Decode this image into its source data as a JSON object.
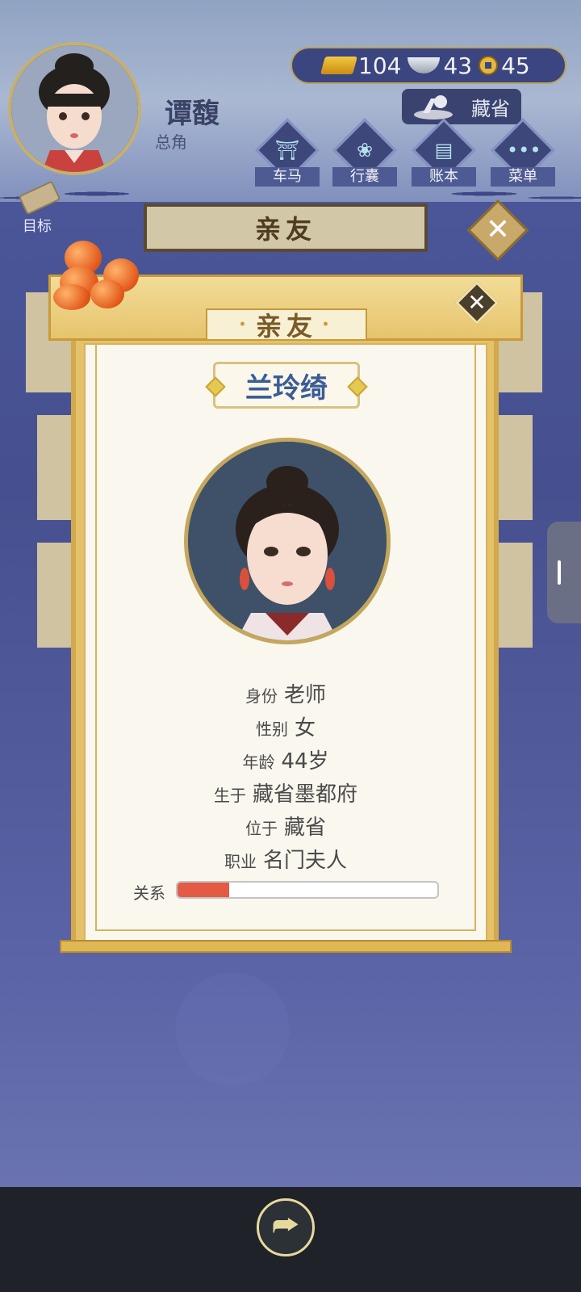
{
  "player": {
    "name": "谭馥",
    "role": "总角"
  },
  "currency": {
    "gold": "104",
    "silver": "43",
    "copper": "45"
  },
  "location": {
    "label": "藏省"
  },
  "menu": {
    "items": [
      {
        "label": "车马",
        "icon": "carriage-icon"
      },
      {
        "label": "行囊",
        "icon": "bag-icon"
      },
      {
        "label": "账本",
        "icon": "ledger-icon"
      },
      {
        "label": "菜单",
        "icon": "menu-dots-icon"
      }
    ]
  },
  "goal": {
    "label": "目标"
  },
  "screen": {
    "title": "亲友",
    "close": "✕"
  },
  "modal": {
    "title": "亲友",
    "close": "✕",
    "character_name": "兰玲绮",
    "fields": [
      {
        "key": "身份",
        "value": "老师"
      },
      {
        "key": "性别",
        "value": "女"
      },
      {
        "key": "年龄",
        "value": "44岁"
      },
      {
        "key": "生于",
        "value": "藏省墨都府"
      },
      {
        "key": "位于",
        "value": "藏省"
      },
      {
        "key": "职业",
        "value": "名门夫人"
      }
    ],
    "relationship": {
      "label": "关系",
      "fraction": 0.2,
      "color": "#e35b44"
    }
  },
  "navbar": {
    "share_glyph": "⮫"
  },
  "colors": {
    "background": "#4a5296",
    "gold_accent": "#d6b35c",
    "name_blue": "#3a5d97"
  }
}
